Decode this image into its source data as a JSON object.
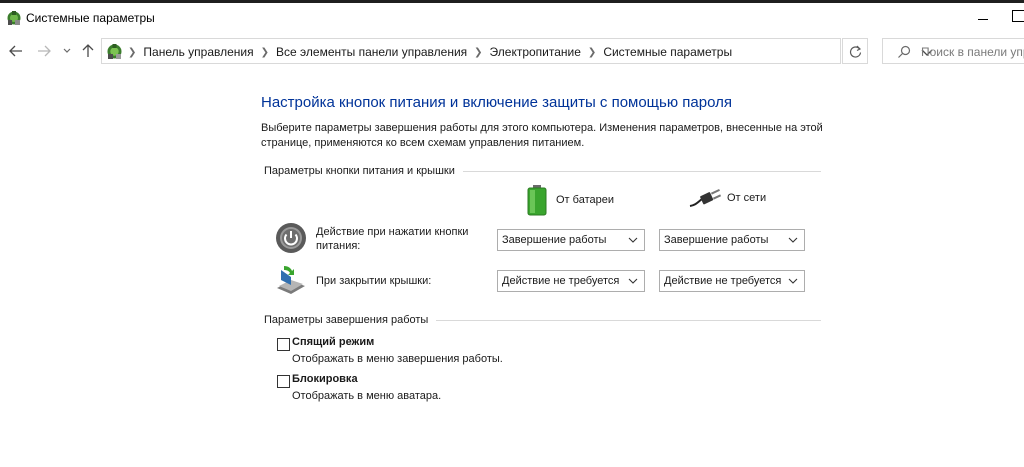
{
  "window": {
    "title": "Системные параметры"
  },
  "address_bar": {
    "breadcrumbs": [
      "Панель управления",
      "Все элементы панели управления",
      "Электропитание",
      "Системные параметры"
    ],
    "search_placeholder": "Поиск в панели упр"
  },
  "main": {
    "title": "Настройка кнопок питания и включение защиты с помощью пароля",
    "description": "Выберите параметры завершения работы для этого компьютера. Изменения параметров, внесенные на этой странице, применяются ко всем схемам управления питанием.",
    "power_section": {
      "header": "Параметры кнопки питания и крышки",
      "columns": {
        "battery": "От батареи",
        "plugged": "От сети"
      },
      "rows": [
        {
          "label": "Действие при нажатии кнопки питания:",
          "battery_value": "Завершение работы",
          "plugged_value": "Завершение работы",
          "icon": "power-button-icon"
        },
        {
          "label": "При закрытии крышки:",
          "battery_value": "Действие не требуется",
          "plugged_value": "Действие не требуется",
          "icon": "laptop-lid-icon"
        }
      ]
    },
    "shutdown_section": {
      "header": "Параметры завершения работы",
      "options": [
        {
          "title": "Спящий режим",
          "description": "Отображать в меню завершения работы.",
          "checked": false
        },
        {
          "title": "Блокировка",
          "description": "Отображать в меню аватара.",
          "checked": false
        }
      ]
    }
  },
  "colors": {
    "title_blue": "#003399",
    "border_gray": "#adadad",
    "rule_gray": "#d9d9d9"
  }
}
